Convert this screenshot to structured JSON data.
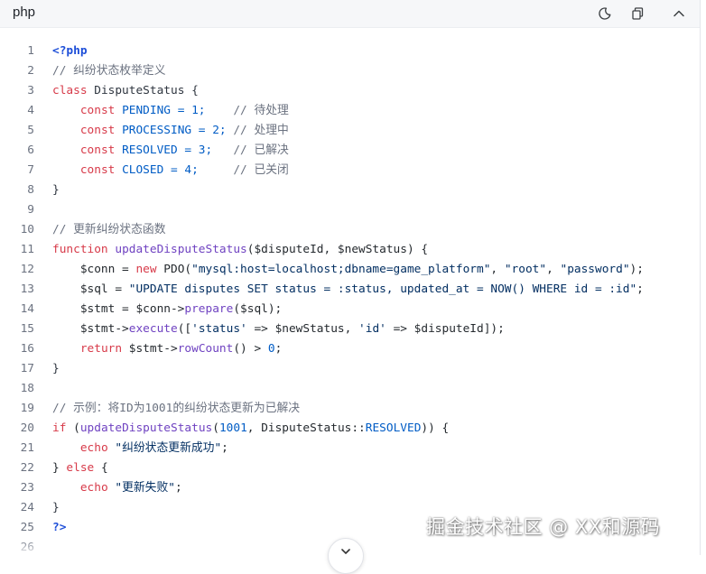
{
  "header": {
    "language": "php",
    "icons": [
      "theme-toggle-icon",
      "copy-icon",
      "collapse-icon"
    ]
  },
  "lines": [
    {
      "n": "1",
      "tokens": [
        {
          "t": "<?php",
          "c": "tag"
        }
      ]
    },
    {
      "n": "2",
      "tokens": [
        {
          "t": "// 纠纷状态枚举定义",
          "c": "cm"
        }
      ]
    },
    {
      "n": "3",
      "tokens": [
        {
          "t": "class",
          "c": "kw"
        },
        {
          "t": " DisputeStatus {",
          "c": "cls"
        }
      ]
    },
    {
      "n": "4",
      "tokens": [
        {
          "t": "    ",
          "c": ""
        },
        {
          "t": "const",
          "c": "kw"
        },
        {
          "t": " PENDING = 1;",
          "c": "cst"
        },
        {
          "t": "    // 待处理",
          "c": "cm"
        }
      ]
    },
    {
      "n": "5",
      "tokens": [
        {
          "t": "    ",
          "c": ""
        },
        {
          "t": "const",
          "c": "kw"
        },
        {
          "t": " PROCESSING = 2;",
          "c": "cst"
        },
        {
          "t": " // 处理中",
          "c": "cm"
        }
      ]
    },
    {
      "n": "6",
      "tokens": [
        {
          "t": "    ",
          "c": ""
        },
        {
          "t": "const",
          "c": "kw"
        },
        {
          "t": " RESOLVED = 3;",
          "c": "cst"
        },
        {
          "t": "   // 已解决",
          "c": "cm"
        }
      ]
    },
    {
      "n": "7",
      "tokens": [
        {
          "t": "    ",
          "c": ""
        },
        {
          "t": "const",
          "c": "kw"
        },
        {
          "t": " CLOSED = 4;",
          "c": "cst"
        },
        {
          "t": "     // 已关闭",
          "c": "cm"
        }
      ]
    },
    {
      "n": "8",
      "tokens": [
        {
          "t": "}",
          "c": "cls"
        }
      ]
    },
    {
      "n": "9",
      "tokens": []
    },
    {
      "n": "10",
      "tokens": [
        {
          "t": "// 更新纠纷状态函数",
          "c": "cm"
        }
      ]
    },
    {
      "n": "11",
      "tokens": [
        {
          "t": "function",
          "c": "kw"
        },
        {
          "t": " ",
          "c": ""
        },
        {
          "t": "updateDisputeStatus",
          "c": "fn"
        },
        {
          "t": "($disputeId, $newStatus) {",
          "c": "var"
        }
      ]
    },
    {
      "n": "12",
      "tokens": [
        {
          "t": "    $conn = ",
          "c": "var"
        },
        {
          "t": "new",
          "c": "kw"
        },
        {
          "t": " PDO(",
          "c": "var"
        },
        {
          "t": "\"mysql:host=localhost;dbname=game_platform\"",
          "c": "str"
        },
        {
          "t": ", ",
          "c": "var"
        },
        {
          "t": "\"root\"",
          "c": "str"
        },
        {
          "t": ", ",
          "c": "var"
        },
        {
          "t": "\"password\"",
          "c": "str"
        },
        {
          "t": ");",
          "c": "var"
        }
      ]
    },
    {
      "n": "13",
      "tokens": [
        {
          "t": "    $sql = ",
          "c": "var"
        },
        {
          "t": "\"UPDATE disputes SET status = :status, updated_at = NOW() WHERE id = :id\"",
          "c": "str"
        },
        {
          "t": ";",
          "c": "var"
        }
      ]
    },
    {
      "n": "14",
      "tokens": [
        {
          "t": "    $stmt = $conn->",
          "c": "var"
        },
        {
          "t": "prepare",
          "c": "fn"
        },
        {
          "t": "($sql);",
          "c": "var"
        }
      ]
    },
    {
      "n": "15",
      "tokens": [
        {
          "t": "    $stmt->",
          "c": "var"
        },
        {
          "t": "execute",
          "c": "fn"
        },
        {
          "t": "([",
          "c": "var"
        },
        {
          "t": "'status'",
          "c": "str"
        },
        {
          "t": " => $newStatus, ",
          "c": "var"
        },
        {
          "t": "'id'",
          "c": "str"
        },
        {
          "t": " => $disputeId]);",
          "c": "var"
        }
      ]
    },
    {
      "n": "16",
      "tokens": [
        {
          "t": "    ",
          "c": ""
        },
        {
          "t": "return",
          "c": "kw"
        },
        {
          "t": " $stmt->",
          "c": "var"
        },
        {
          "t": "rowCount",
          "c": "fn"
        },
        {
          "t": "() > ",
          "c": "var"
        },
        {
          "t": "0",
          "c": "cst"
        },
        {
          "t": ";",
          "c": "var"
        }
      ]
    },
    {
      "n": "17",
      "tokens": [
        {
          "t": "}",
          "c": "cls"
        }
      ]
    },
    {
      "n": "18",
      "tokens": []
    },
    {
      "n": "19",
      "tokens": [
        {
          "t": "// 示例：将ID为1001的纠纷状态更新为已解决",
          "c": "cm"
        }
      ]
    },
    {
      "n": "20",
      "tokens": [
        {
          "t": "if",
          "c": "kw"
        },
        {
          "t": " (",
          "c": "var"
        },
        {
          "t": "updateDisputeStatus",
          "c": "fn"
        },
        {
          "t": "(",
          "c": "var"
        },
        {
          "t": "1001",
          "c": "cst"
        },
        {
          "t": ", DisputeStatus::",
          "c": "var"
        },
        {
          "t": "RESOLVED",
          "c": "cst"
        },
        {
          "t": ")) {",
          "c": "var"
        }
      ]
    },
    {
      "n": "21",
      "tokens": [
        {
          "t": "    ",
          "c": ""
        },
        {
          "t": "echo",
          "c": "kw"
        },
        {
          "t": " ",
          "c": ""
        },
        {
          "t": "\"纠纷状态更新成功\"",
          "c": "str"
        },
        {
          "t": ";",
          "c": "var"
        }
      ]
    },
    {
      "n": "22",
      "tokens": [
        {
          "t": "} ",
          "c": "var"
        },
        {
          "t": "else",
          "c": "kw"
        },
        {
          "t": " {",
          "c": "var"
        }
      ]
    },
    {
      "n": "23",
      "tokens": [
        {
          "t": "    ",
          "c": ""
        },
        {
          "t": "echo",
          "c": "kw"
        },
        {
          "t": " ",
          "c": ""
        },
        {
          "t": "\"更新失败\"",
          "c": "str"
        },
        {
          "t": ";",
          "c": "var"
        }
      ]
    },
    {
      "n": "24",
      "tokens": [
        {
          "t": "}",
          "c": "cls"
        }
      ]
    },
    {
      "n": "25",
      "tokens": [
        {
          "t": "?>",
          "c": "tag"
        }
      ]
    },
    {
      "n": "26",
      "tokens": []
    }
  ],
  "watermark": "掘金技术社区 @ XX和源码",
  "expand_icon": "chevron-down-icon"
}
